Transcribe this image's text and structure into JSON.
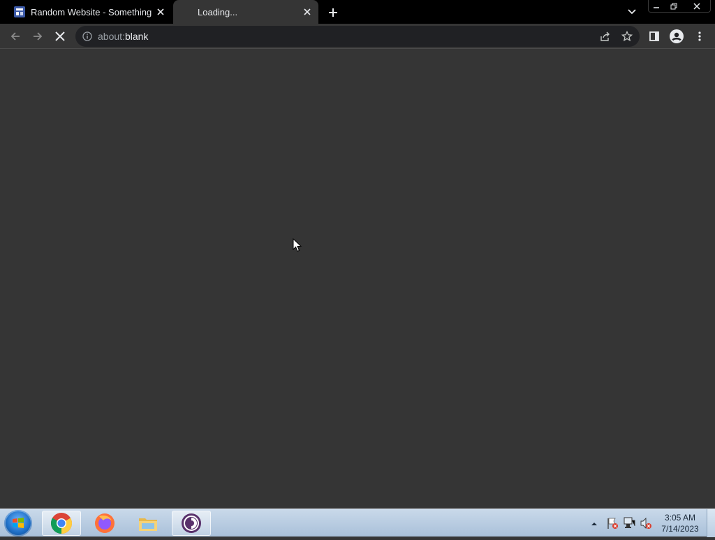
{
  "browser": {
    "tabs": [
      {
        "title": "Random Website - Something",
        "state": "loaded"
      },
      {
        "title": "Loading...",
        "state": "loading"
      }
    ],
    "address": {
      "scheme": "about:",
      "host": "blank"
    }
  },
  "icons": {
    "favicon": "website-favicon",
    "new_tab": "plus-icon",
    "tab_search": "chevron-down-icon",
    "back": "arrow-left-icon",
    "forward": "arrow-right-icon",
    "stop": "close-icon",
    "site_info": "info-icon",
    "share": "share-icon",
    "bookmark": "star-icon",
    "side_panel": "side-panel-icon",
    "profile": "profile-icon",
    "menu": "kebab-menu-icon"
  },
  "taskbar": {
    "pinned": [
      "Google Chrome",
      "Firefox",
      "File Explorer",
      "Tor Browser"
    ],
    "clock": {
      "time": "3:05 AM",
      "date": "7/14/2023"
    }
  },
  "colors": {
    "tabstrip": "#000000",
    "toolbar": "#353535",
    "omnibox": "#202124",
    "content": "#353535",
    "taskbar": "#b9cde2"
  }
}
